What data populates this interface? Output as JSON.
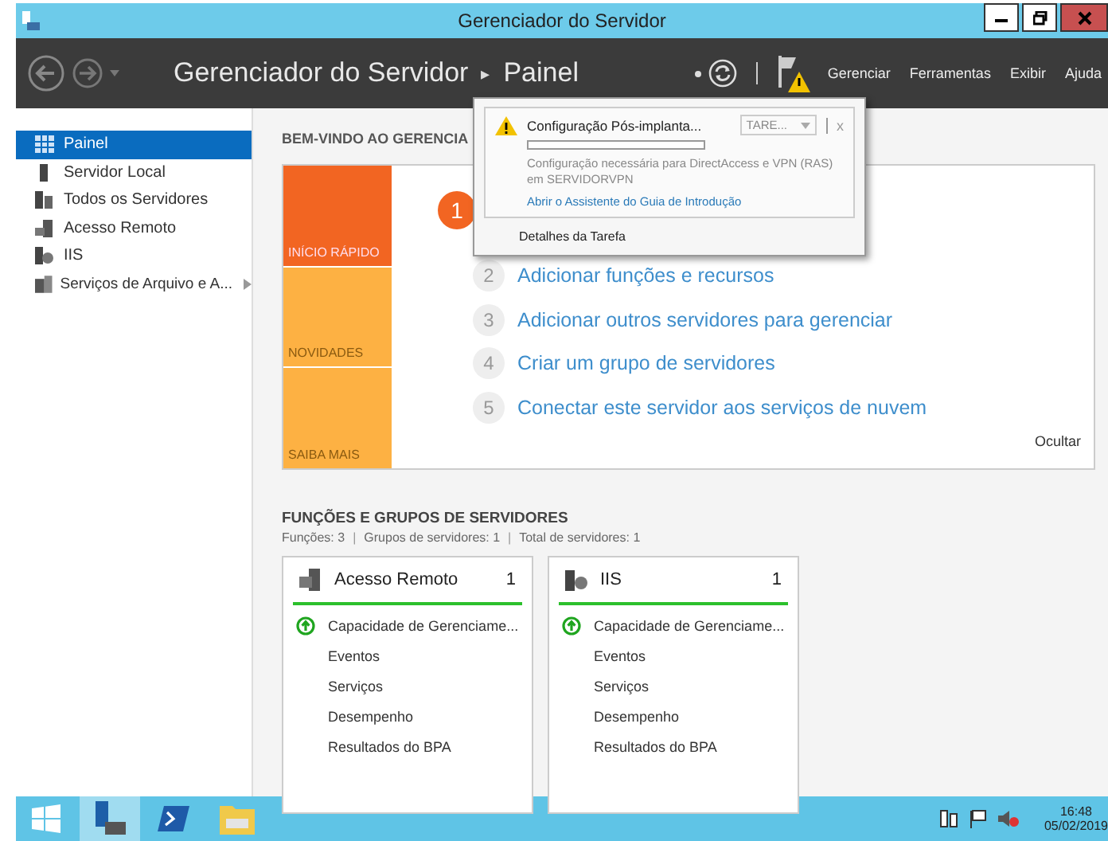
{
  "window": {
    "title": "Gerenciador do Servidor"
  },
  "toolbar": {
    "breadcrumb": [
      "Gerenciador do Servidor",
      "Painel"
    ],
    "separator": "▸",
    "menus": [
      "Gerenciar",
      "Ferramentas",
      "Exibir",
      "Ajuda"
    ]
  },
  "sidebar": {
    "items": [
      {
        "label": "Painel",
        "selected": true,
        "submenu": false
      },
      {
        "label": "Servidor Local",
        "selected": false,
        "submenu": false
      },
      {
        "label": "Todos os Servidores",
        "selected": false,
        "submenu": false
      },
      {
        "label": "Acesso Remoto",
        "selected": false,
        "submenu": false
      },
      {
        "label": "IIS",
        "selected": false,
        "submenu": false
      },
      {
        "label": "Serviços de Arquivo e A...",
        "selected": false,
        "submenu": true
      }
    ]
  },
  "welcome": {
    "heading": "BEM-VINDO AO GERENCIA",
    "tiles": [
      {
        "label": "INÍCIO RÁPIDO",
        "selected": true
      },
      {
        "label": "NOVIDADES",
        "selected": false
      },
      {
        "label": "SAIBA MAIS",
        "selected": false
      }
    ],
    "steps": [
      {
        "number": "1",
        "highlighted": true
      },
      {
        "number": "2",
        "text": "Adicionar funções e recursos",
        "highlighted": false
      },
      {
        "number": "3",
        "text": "Adicionar outros servidores para gerenciar",
        "highlighted": false
      },
      {
        "number": "4",
        "text": "Criar um grupo de servidores",
        "highlighted": false
      },
      {
        "number": "5",
        "text": "Conectar este servidor aos serviços de nuvem",
        "highlighted": false
      }
    ],
    "hide": "Ocultar"
  },
  "roles": {
    "heading": "FUNÇÕES E GRUPOS DE SERVIDORES",
    "separator": "|",
    "summary": [
      "Funções: 3",
      "Grupos de servidores: 1",
      "Total de servidores: 1"
    ],
    "cards": [
      {
        "name": "Acesso Remoto",
        "count": "1",
        "rows": [
          {
            "text": "Capacidade de Gerenciame...",
            "kind": "health"
          },
          {
            "text": "Eventos",
            "kind": "plain"
          },
          {
            "text": "Serviços",
            "kind": "plain"
          },
          {
            "text": "Desempenho",
            "kind": "plain"
          },
          {
            "text": "Resultados do BPA",
            "kind": "plain"
          }
        ]
      },
      {
        "name": "IIS",
        "count": "1",
        "rows": [
          {
            "text": "Capacidade de Gerenciame...",
            "kind": "health"
          },
          {
            "text": "Eventos",
            "kind": "plain"
          },
          {
            "text": "Serviços",
            "kind": "plain"
          },
          {
            "text": "Desempenho",
            "kind": "plain"
          },
          {
            "text": "Resultados do BPA",
            "kind": "plain"
          }
        ]
      }
    ]
  },
  "notification": {
    "title": "Configuração Pós-implanta...",
    "task_button": "TARE...",
    "close": "x",
    "progress": {
      "level": 0
    },
    "message": "Configuração necessária para DirectAccess e VPN (RAS) em SERVIDORVPN",
    "link": "Abrir o Assistente do Guia de Introdução",
    "footer": "Detalhes da Tarefa"
  },
  "taskbar": {
    "time": "16:48",
    "date": "05/02/2019"
  }
}
